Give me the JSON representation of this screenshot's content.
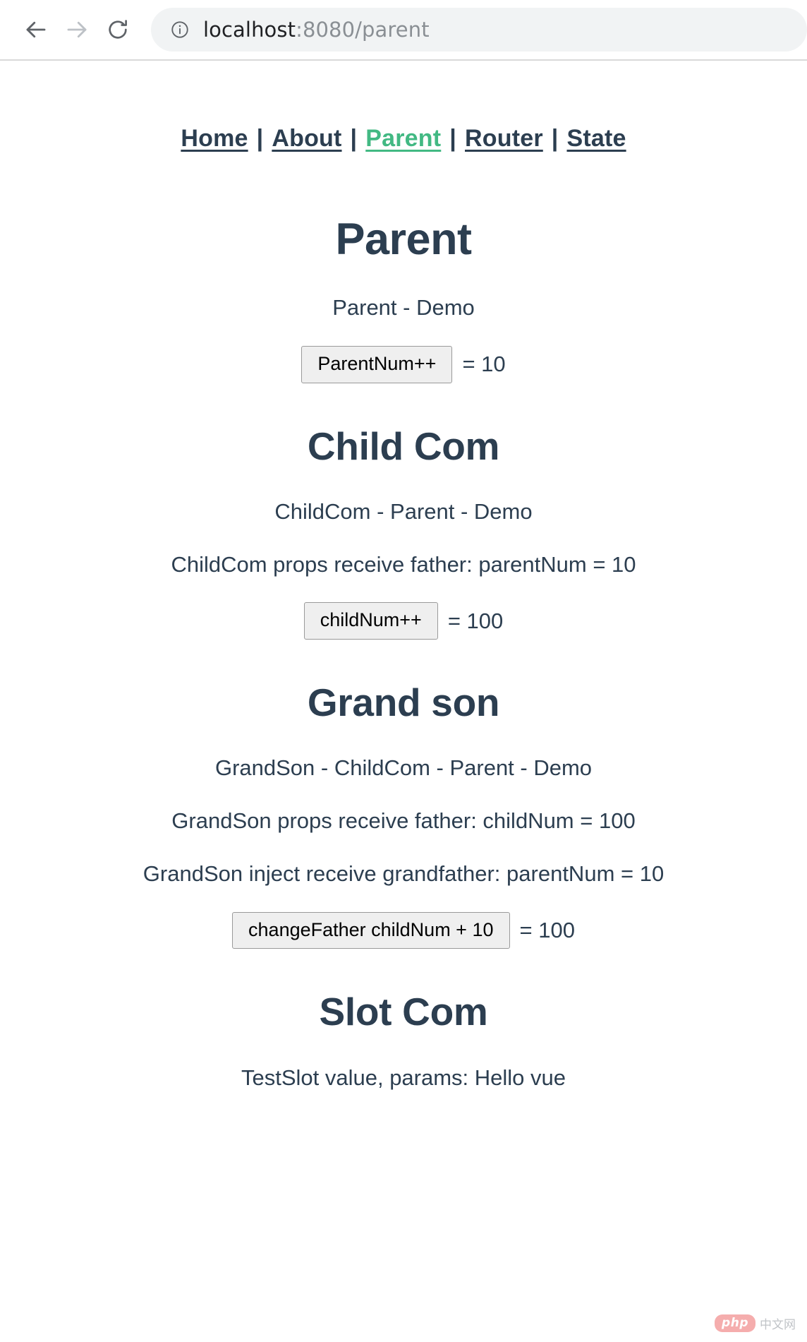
{
  "browser": {
    "back_label": "back-arrow",
    "forward_label": "forward-arrow",
    "reload_label": "reload",
    "security_icon": "info-circle",
    "url_host": "localhost",
    "url_rest": ":8080/parent"
  },
  "nav": {
    "separator": "|",
    "links": [
      {
        "label": "Home",
        "active": false
      },
      {
        "label": "About",
        "active": false
      },
      {
        "label": "Parent",
        "active": true
      },
      {
        "label": "Router",
        "active": false
      },
      {
        "label": "State",
        "active": false
      }
    ]
  },
  "parent": {
    "title": "Parent",
    "trace": "Parent - Demo",
    "button_label": "ParentNum++",
    "value_text": "= 10"
  },
  "child": {
    "title": "Child Com",
    "trace": "ChildCom - Parent - Demo",
    "props_line": "ChildCom props receive father: parentNum = 10",
    "button_label": "childNum++",
    "value_text": "= 100"
  },
  "grandson": {
    "title": "Grand son",
    "trace": "GrandSon - ChildCom - Parent - Demo",
    "props_line": "GrandSon props receive father: childNum = 100",
    "inject_line": "GrandSon inject receive grandfather: parentNum = 10",
    "button_label": "changeFather childNum + 10",
    "value_text": "= 100"
  },
  "slot": {
    "title": "Slot Com",
    "line": "TestSlot value, params: Hello vue"
  },
  "watermark": {
    "brand": "php",
    "suffix": "中文网"
  },
  "colors": {
    "text": "#2c3e50",
    "active_link": "#42b983",
    "omnibox_bg": "#f1f3f4",
    "button_bg": "#efefef"
  }
}
